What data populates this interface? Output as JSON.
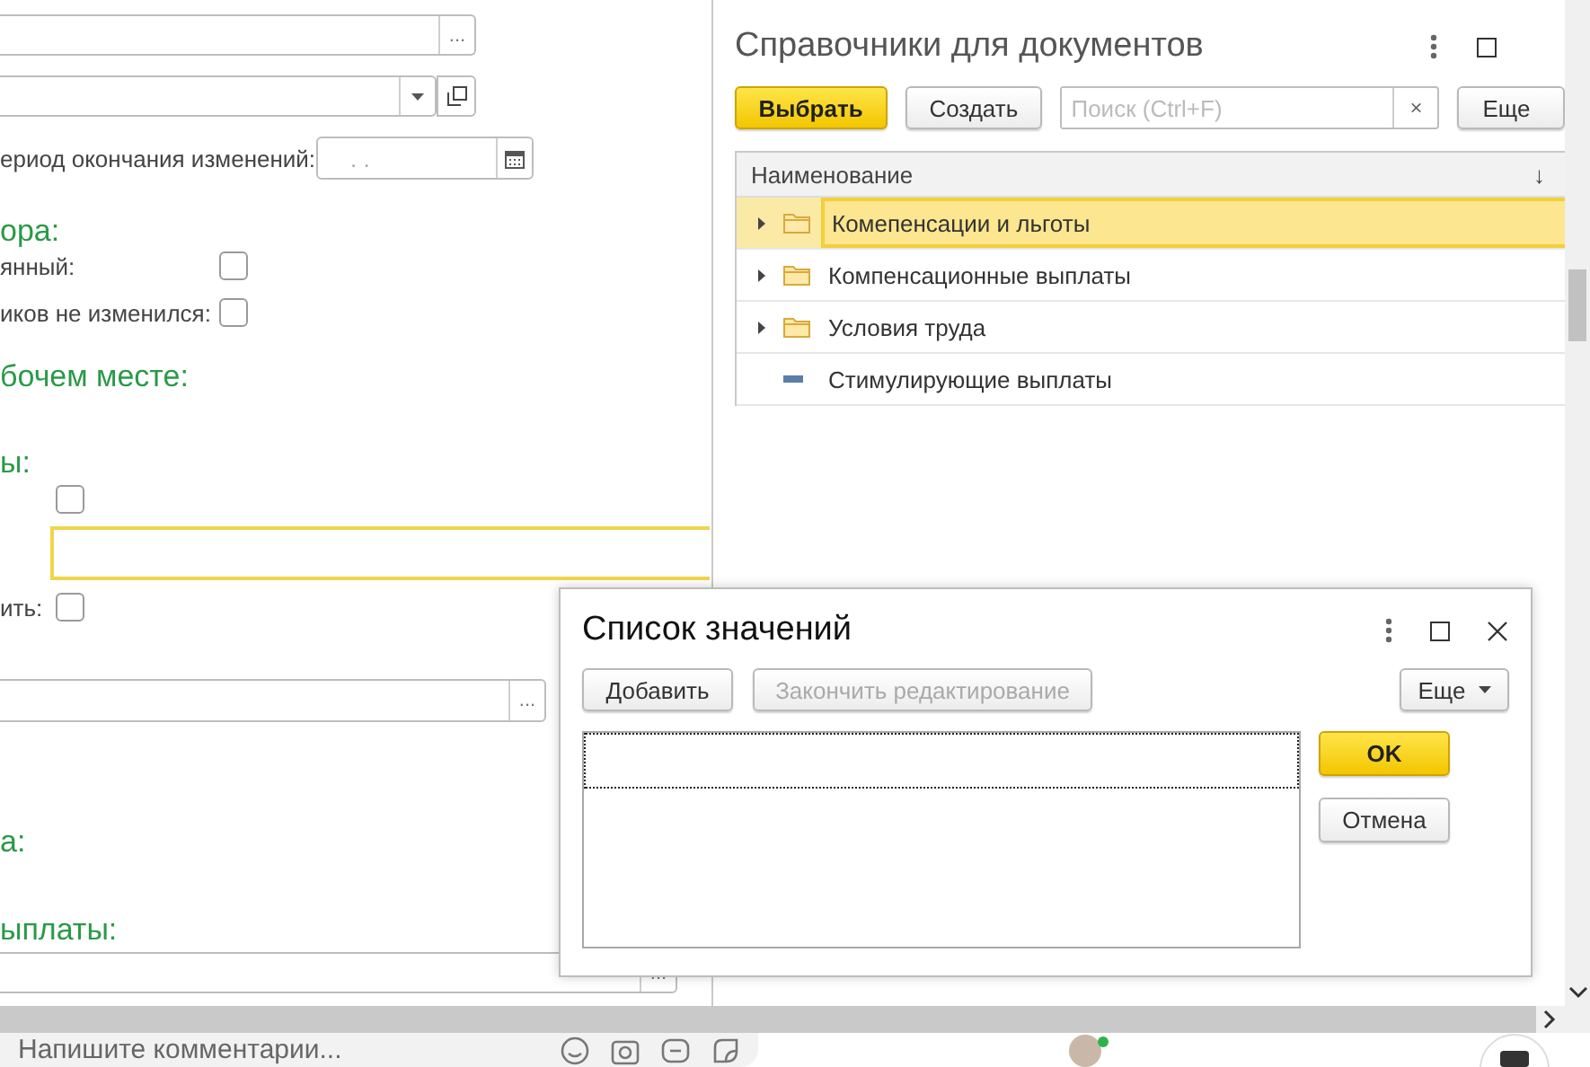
{
  "background_form": {
    "rows": [
      {
        "kind": "field",
        "focused": false,
        "button": "..."
      },
      {
        "kind": "combo",
        "focused": false
      },
      {
        "kind": "date",
        "label": "ериод окончания изменений:",
        "placeholder": ". ."
      },
      {
        "kind": "heading",
        "text": "ора:"
      },
      {
        "kind": "checkbox",
        "label": "янный:",
        "checked": false
      },
      {
        "kind": "checkbox",
        "label": "иков не изменился:",
        "checked": false
      },
      {
        "kind": "heading",
        "text": "бочем месте:"
      },
      {
        "kind": "heading",
        "text": "ы:"
      },
      {
        "kind": "checkbox",
        "checked": false
      },
      {
        "kind": "field",
        "focused": true
      },
      {
        "kind": "checkbox",
        "label": "ить:",
        "checked": false
      },
      {
        "kind": "field",
        "focused": false,
        "button": "..."
      },
      {
        "kind": "heading",
        "text": "а:"
      },
      {
        "kind": "heading",
        "text": "ыплаты:"
      },
      {
        "kind": "field",
        "focused": false,
        "button": "..."
      }
    ]
  },
  "directory_window": {
    "title": "Справочники для документов",
    "buttons": [
      {
        "label": "Выбрать",
        "kind": "primary"
      },
      {
        "label": "Создать",
        "kind": "normal"
      }
    ],
    "search": {
      "placeholder": "Поиск (Ctrl+F)",
      "clear": "×"
    },
    "more_button": "Еще",
    "column": "Наименование",
    "sort": "↓",
    "rows": [
      {
        "name": "Комепенсации и льготы",
        "kind": "group",
        "selected": true
      },
      {
        "name": "Компенсационные выплаты",
        "kind": "group",
        "selected": false
      },
      {
        "name": "Условия труда",
        "kind": "group",
        "selected": false
      },
      {
        "name": "Стимулирующие выплаты",
        "kind": "item",
        "selected": false
      }
    ]
  },
  "list_window": {
    "title": "Список значений",
    "buttons": [
      {
        "label": "Добавить",
        "disabled": false
      },
      {
        "label": "Закончить редактирование",
        "disabled": true
      }
    ],
    "more_button": "Еще",
    "ok": "OK",
    "cancel": "Отмена"
  },
  "comment_bar": {
    "placeholder": "Напишите комментарии..."
  }
}
